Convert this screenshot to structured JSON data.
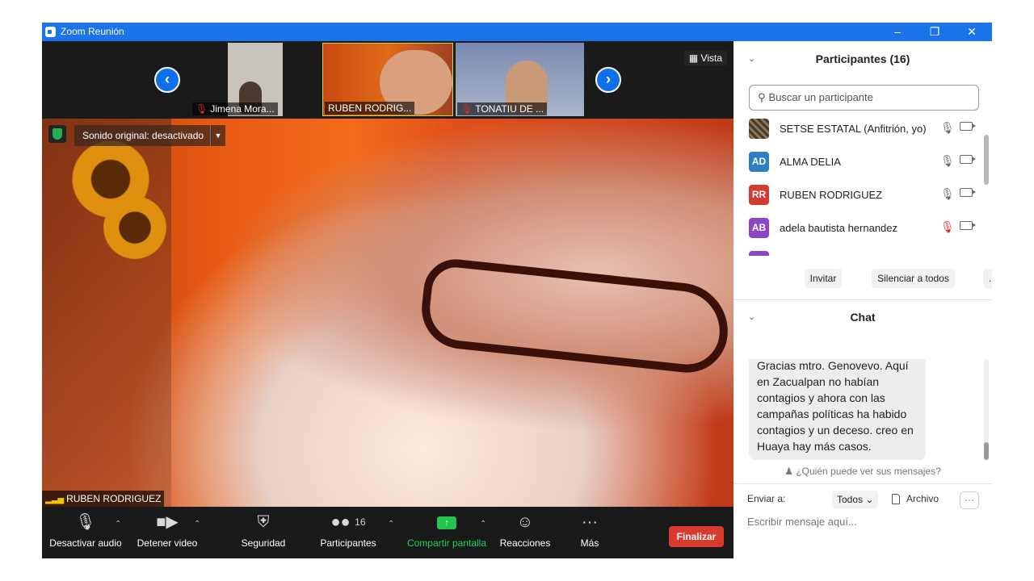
{
  "window": {
    "title": "Zoom Reunión"
  },
  "thumbnails": [
    {
      "name": "Jimena Mora...",
      "muted": true
    },
    {
      "name": "RUBEN RODRIG...",
      "muted": false
    },
    {
      "name": "TONATIU DE ...",
      "muted": true
    }
  ],
  "view_label": "Vista",
  "original_sound_label": "Sonido original: desactivado",
  "speaker_name": "RUBEN RODRIGUEZ",
  "toolbar": {
    "audio_label": "Desactivar audio",
    "video_label": "Detener video",
    "security_label": "Seguridad",
    "participants_label": "Participantes",
    "participants_count": "16",
    "share_label": "Compartir pantalla",
    "reactions_label": "Reacciones",
    "more_label": "Más",
    "end_label": "Finalizar"
  },
  "participants_panel": {
    "title": "Participantes (16)",
    "search_placeholder": "Buscar un participante",
    "participants": [
      {
        "initials": "",
        "name": "SETSE ESTATAL (Anfitrión, yo)",
        "color": "#6b5a40",
        "muted": false
      },
      {
        "initials": "AD",
        "name": "ALMA DELIA",
        "color": "#2e7fc4",
        "muted": false
      },
      {
        "initials": "RR",
        "name": "RUBEN RODRIGUEZ",
        "color": "#d23b2f",
        "muted": false
      },
      {
        "initials": "AB",
        "name": "adela bautista hernandez",
        "color": "#8e44c4",
        "muted": true
      }
    ],
    "invite_label": "Invitar",
    "mute_all_label": "Silenciar a todos",
    "more_label": "..."
  },
  "chat_panel": {
    "title": "Chat",
    "message": "Gracias mtro. Genovevo. Aquí en Zacualpan no habían contagios y ahora con las campañas políticas ha habido contagios y un deceso. creo en Huaya hay más casos.",
    "who_can_see": "¿Quién puede ver sus mensajes?",
    "send_to_label": "Enviar a:",
    "send_to_value": "Todos",
    "file_label": "Archivo",
    "input_placeholder": "Escribir mensaje aquí..."
  }
}
